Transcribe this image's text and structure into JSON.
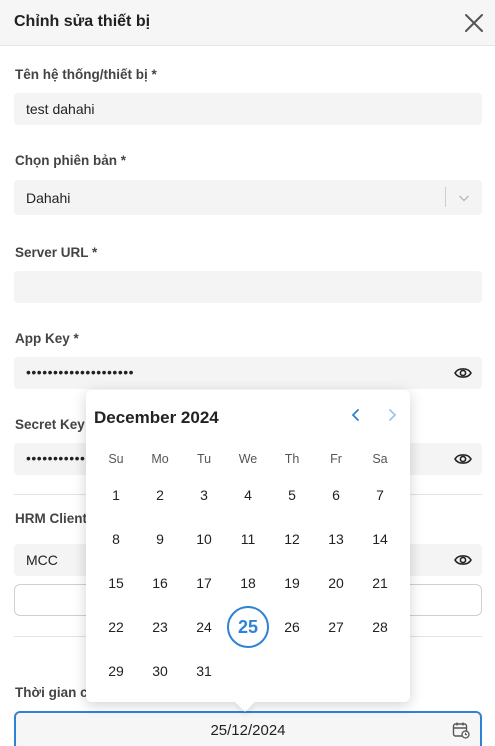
{
  "dialog": {
    "title": "Chỉnh sửa thiết bị"
  },
  "fields": {
    "system_name": {
      "label": "Tên hệ thống/thiết bị *",
      "value": "test dahahi"
    },
    "version": {
      "label": "Chọn phiên bản *",
      "value": "Dahahi"
    },
    "server_url": {
      "label": "Server URL *",
      "value": ""
    },
    "app_key": {
      "label": "App Key *",
      "value": "••••••••••••••••••••"
    },
    "secret_key": {
      "label": "Secret Key",
      "value": "•••••••••••"
    },
    "hrm_client": {
      "label": "HRM Client",
      "value": "MCC"
    },
    "time": {
      "label": "Thời gian c",
      "value": "25/12/2024"
    }
  },
  "datepicker": {
    "month_label": "December 2024",
    "weekdays": [
      "Su",
      "Mo",
      "Tu",
      "We",
      "Th",
      "Fr",
      "Sa"
    ],
    "days": [
      "1",
      "2",
      "3",
      "4",
      "5",
      "6",
      "7",
      "8",
      "9",
      "10",
      "11",
      "12",
      "13",
      "14",
      "15",
      "16",
      "17",
      "18",
      "19",
      "20",
      "21",
      "22",
      "23",
      "24",
      "25",
      "26",
      "27",
      "28",
      "29",
      "30",
      "31"
    ],
    "first_weekday_index": 0,
    "selected_day": "25"
  },
  "colors": {
    "accent": "#2f83d6",
    "field_bg": "#f4f4f4"
  }
}
